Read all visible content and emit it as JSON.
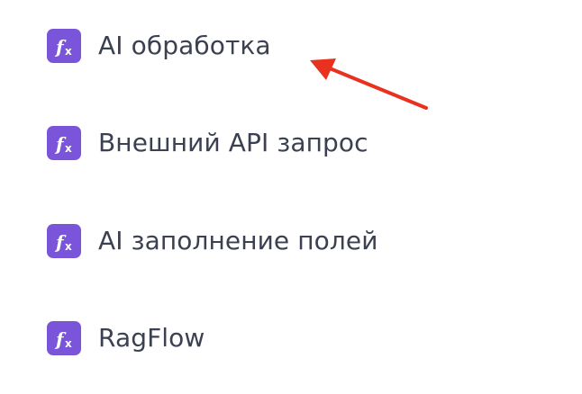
{
  "colors": {
    "badge": "#7a55d9",
    "label": "#3b4150",
    "arrow": "#e8321f",
    "background": "#ffffff"
  },
  "menu": {
    "items": [
      {
        "icon": "function-icon",
        "label": "AI обработка"
      },
      {
        "icon": "function-icon",
        "label": "Внешний API запрос"
      },
      {
        "icon": "function-icon",
        "label": "AI заполнение полей"
      },
      {
        "icon": "function-icon",
        "label": "RagFlow"
      }
    ]
  },
  "annotation": {
    "icon": "arrow-pointer-icon",
    "target": "AI обработка"
  }
}
